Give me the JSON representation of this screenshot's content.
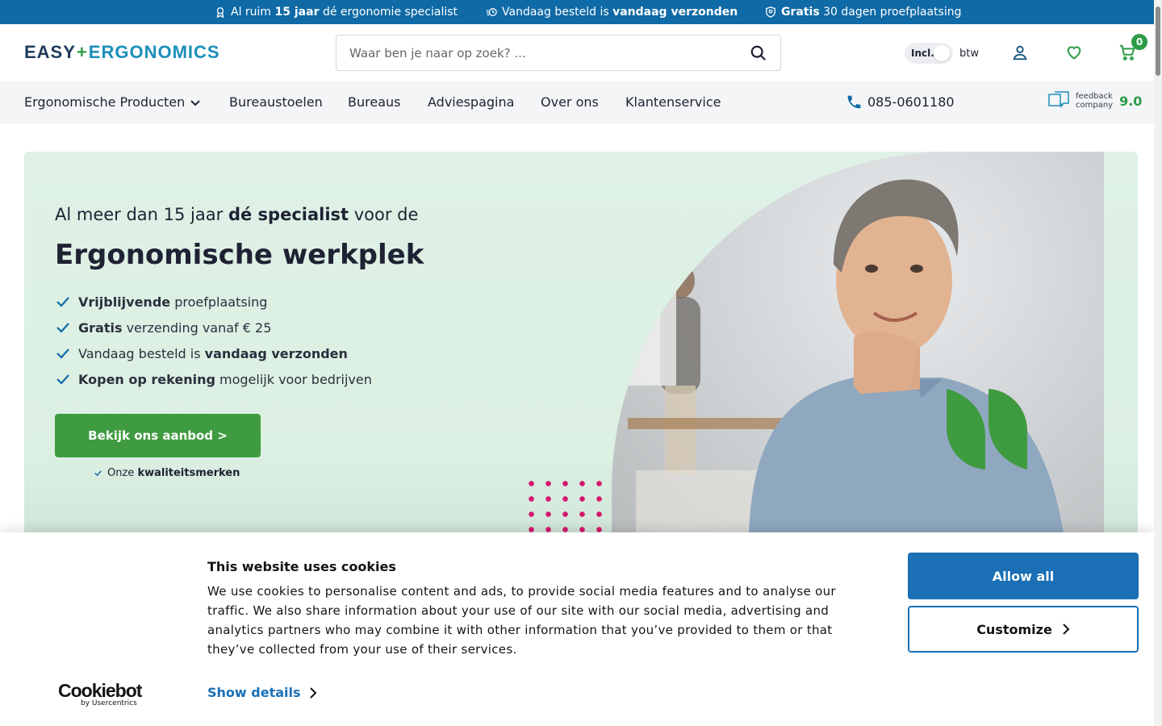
{
  "topbar": {
    "usp1": {
      "pre": "Al ruim ",
      "bold": "15 jaar",
      "post": " dé ergonomie specialist"
    },
    "usp2": {
      "pre": "Vandaag besteld is ",
      "bold": "vandaag verzonden",
      "post": ""
    },
    "usp3": {
      "pre": "",
      "bold": "Gratis",
      "post": " 30 dagen proefplaatsing"
    }
  },
  "header": {
    "logo_part1": "EASY",
    "logo_part2": "ERGONOMICS",
    "search_placeholder": "Waar ben je naar op zoek? ...",
    "btw_toggle_label": "Incl.",
    "btw_label": "btw",
    "cart_count": "0"
  },
  "nav": {
    "items": [
      "Ergonomische Producten",
      "Bureaustoelen",
      "Bureaus",
      "Adviespagina",
      "Over ons",
      "Klantenservice"
    ],
    "phone": "085-0601180",
    "feedback_line1": "feedback",
    "feedback_line2": "company",
    "feedback_score": "9.0"
  },
  "hero": {
    "subtitle_pre": "Al meer dan 15 jaar ",
    "subtitle_bold": "dé specialist",
    "subtitle_post": " voor de",
    "title": "Ergonomische werkplek",
    "usps": [
      {
        "bold": "Vrijblijvende",
        "text": " proefplaatsing",
        "bold_first": true
      },
      {
        "bold": "Gratis",
        "text": " verzending vanaf € 25",
        "bold_first": true
      },
      {
        "bold": "vandaag verzonden",
        "text": "Vandaag besteld is ",
        "bold_first": false
      },
      {
        "bold": "Kopen op rekening",
        "text": " mogelijk voor bedrijven",
        "bold_first": true
      }
    ],
    "cta_label": "Bekijk ons aanbod >",
    "brands_pre": "Onze ",
    "brands_bold": "kwaliteitsmerken"
  },
  "cookie": {
    "title": "This website uses cookies",
    "body": "We use cookies to personalise content and ads, to provide social media features and to analyse our traffic. We also share information about your use of our site with our social media, advertising and analytics partners who may combine it with other information that you’ve provided to them or that they’ve collected from your use of their services.",
    "show_details": "Show details",
    "allow_all": "Allow all",
    "customize": "Customize",
    "brand_name": "Cookiebot",
    "brand_sub": "by Usercentrics"
  },
  "colors": {
    "topbar": "#0f6aa6",
    "accent_green": "#3f9b3f",
    "cookie_blue": "#1a6fb5",
    "dots_pink": "#d4166c"
  }
}
